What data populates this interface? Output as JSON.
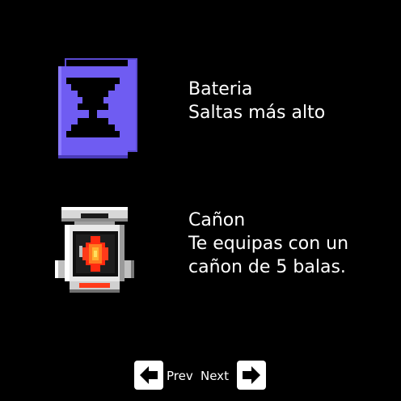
{
  "items": [
    {
      "icon": "battery-icon",
      "name": "Bateria",
      "description_lines": [
        "Saltas más alto"
      ],
      "color": "#6f5cf2"
    },
    {
      "icon": "cannon-icon",
      "name": "Cañon",
      "description_lines": [
        "Te equipas con un",
        "cañon de 5 balas."
      ],
      "color": "#ff3a1a"
    }
  ],
  "nav": {
    "prev_label": "Prev",
    "next_label": "Next",
    "prev_icon": "arrow-left-icon",
    "next_icon": "arrow-right-icon"
  },
  "colors": {
    "background": "#000000",
    "text": "#ffffff",
    "button": "#ffffff"
  }
}
